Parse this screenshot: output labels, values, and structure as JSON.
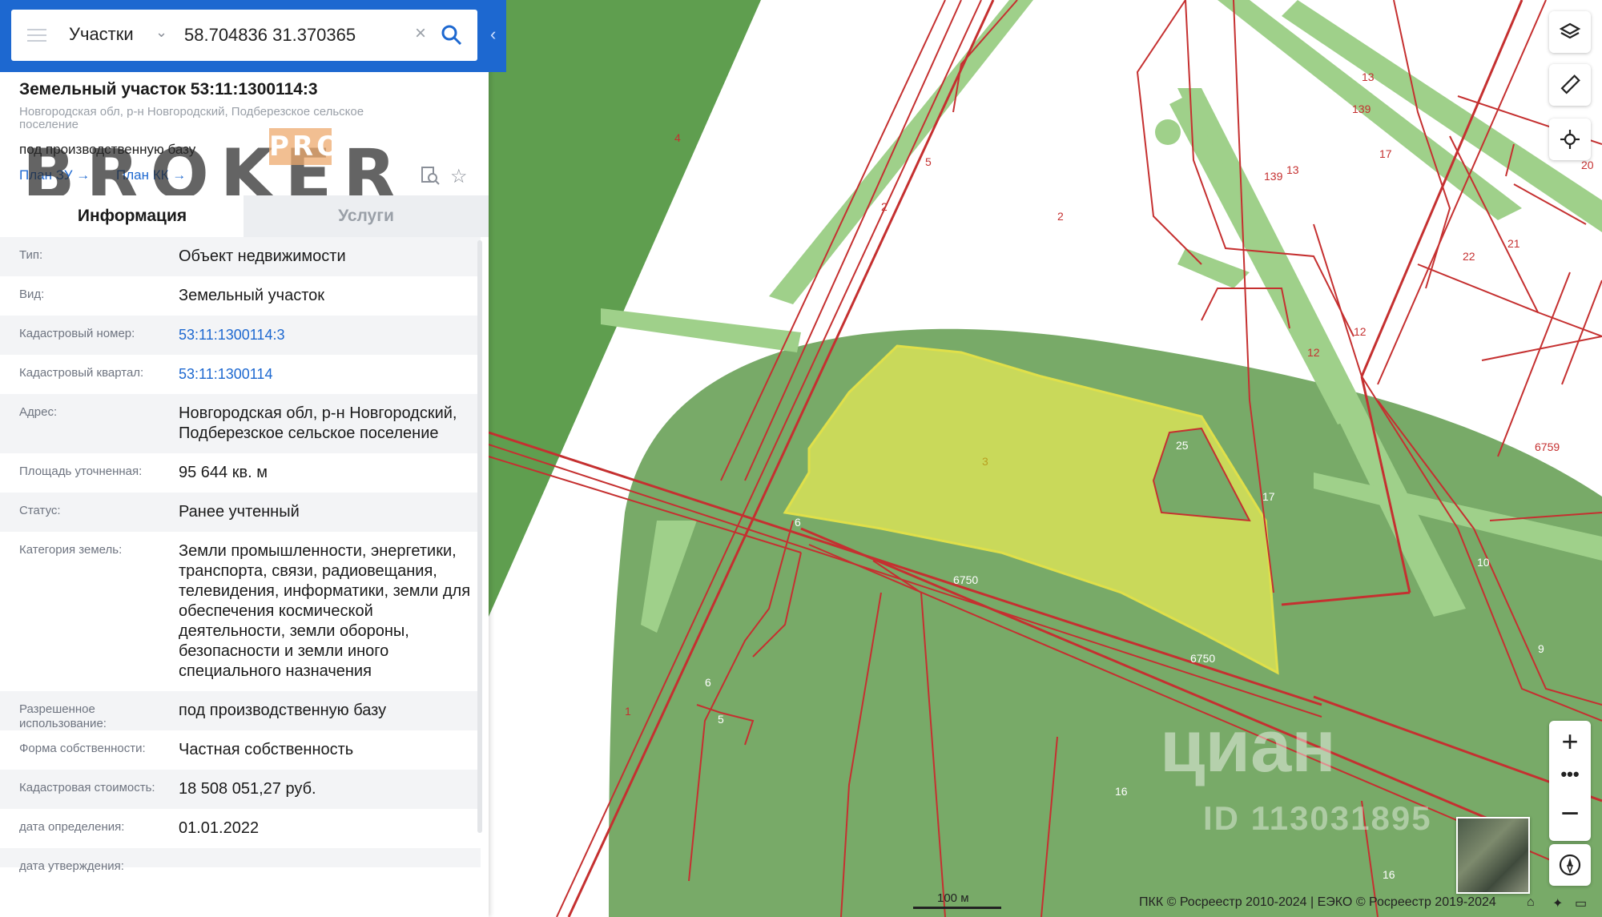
{
  "search": {
    "layer": "Участки",
    "query": "58.704836 31.370365"
  },
  "parcel": {
    "title": "Земельный участок 53:11:1300114:3",
    "address_short": "Новгородская обл, р-н Новгородский, Подберезское сельское поселение",
    "purpose": "под производственную базу",
    "link_plan_zu": "План ЗУ →",
    "link_plan_kk": "План КК →"
  },
  "watermark": {
    "brand": "BROKER",
    "badge": "PRO",
    "cian": "циан",
    "cian_id": "ID 113031895"
  },
  "tabs": {
    "info": "Информация",
    "services": "Услуги"
  },
  "rows": [
    {
      "label": "Тип:",
      "value": "Объект недвижимости"
    },
    {
      "label": "Вид:",
      "value": "Земельный участок"
    },
    {
      "label": "Кадастровый номер:",
      "value": "53:11:1300114:3"
    },
    {
      "label": "Кадастровый квартал:",
      "value": "53:11:1300114"
    },
    {
      "label": "Адрес:",
      "value": "Новгородская обл, р-н Новгородский, Подберезское сельское поселение"
    },
    {
      "label": "Площадь уточненная:",
      "value": "95 644 кв. м"
    },
    {
      "label": "Статус:",
      "value": "Ранее учтенный"
    },
    {
      "label": "Категория земель:",
      "value": "Земли промышленности, энергетики, транспорта, связи, радиовещания, телевидения, информатики, земли для обеспечения космической деятельности, земли обороны, безопасности и земли иного специального назначения"
    },
    {
      "label": "Разрешенное использование:",
      "value": "под производственную базу"
    },
    {
      "label": "Форма собственности:",
      "value": "Частная собственность"
    },
    {
      "label": "Кадастровая стоимость:",
      "value": "18 508 051,27 руб."
    },
    {
      "label": "дата определения:",
      "value": "01.01.2022"
    },
    {
      "label": "дата утверждения:",
      "value": ""
    }
  ],
  "map": {
    "scale": "100 м",
    "copyright": "ПКК © Росреестр 2010-2024 | ЕЭКО © Росреестр 2019-2024",
    "parcel_labels": [
      "4",
      "5",
      "2",
      "2",
      "13",
      "139",
      "139",
      "13",
      "17",
      "22",
      "21",
      "20",
      "12",
      "12",
      "6759",
      "3",
      "25",
      "17",
      "6",
      "6750",
      "6750",
      "10",
      "9",
      "6",
      "5",
      "1",
      "16",
      "16"
    ],
    "colors": {
      "selected_fill": "#c9d95a",
      "zone_fill": "#74a865",
      "strip_fill": "#9ccc87",
      "boundary": "#c53030"
    }
  }
}
